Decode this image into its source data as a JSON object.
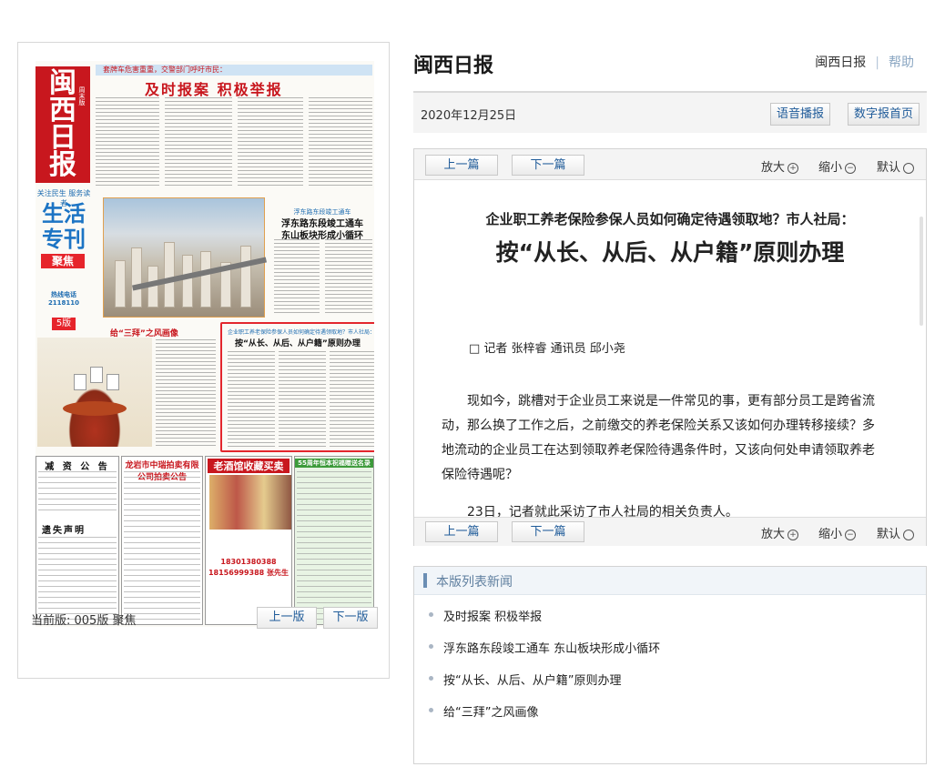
{
  "site": {
    "title": "闽西日报",
    "links": {
      "home": "闽西日报",
      "help": "帮助"
    }
  },
  "date_bar": {
    "date": "2020年12月25日",
    "voice_button": "语音播报",
    "digital_home_button": "数字报首页"
  },
  "newspaper": {
    "masthead_chars": [
      "闽",
      "西",
      "日",
      "报"
    ],
    "masthead_sub": "周末版",
    "slogan": "关注民生  服务读者",
    "life_title_line1": "生活",
    "life_title_line2": "专刊",
    "focus_tag": "聚焦",
    "phone": "热线电话 2118110",
    "page_badge": "5版",
    "banner_top": "套牌车危害重重，交警部门呼吁市民：",
    "big_head": "及时报案  积极举报",
    "sub_head_1_small": "浮东路东段竣工通车",
    "sub_head_1_line1": "浮东路东段竣工通车",
    "sub_head_1_line2": "东山板块形成小循环",
    "sub_head_2": "给“三拜”之风画像",
    "highlight_small": "企业职工养老保险参保人员如何确定待遇领取地？市人社局：",
    "highlight_title": "按“从长、从后、从户籍”原则办理",
    "ad_notice_title": "减 资 公 告",
    "ad_lost_title": "遗失声明",
    "ad_red_title": "龙岩市中瑞拍卖有限公司拍卖公告",
    "ad_collect_title": "老酒馆收藏买卖",
    "ad_collect_phone1": "18301380388",
    "ad_collect_phone2": "18156999388 张先生",
    "ad_green_title": "55周年恒本祝福赠送名录"
  },
  "paper_footer": {
    "current_page_label": "当前版: 005版 聚焦",
    "prev_page": "上一版",
    "next_page": "下一版"
  },
  "article": {
    "prev": "上一篇",
    "next": "下一篇",
    "zoom_in": "放大",
    "zoom_out": "缩小",
    "default": "默认",
    "subtitle": "企业职工养老保险参保人员如何确定待遇领取地？市人社局：",
    "title": "按“从长、从后、从户籍”原则办理",
    "author": "□ 记者 张梓睿 通讯员 邱小尧",
    "paragraph1": "现如今，跳槽对于企业员工来说是一件常见的事，更有部分员工是跨省流动，那么换了工作之后，之前缴交的养老保险关系又该如何办理转移接续？多地流动的企业员工在达到领取养老保险待遇条件时，又该向何处申请领取养老保险待遇呢？",
    "paragraph2": "23日，记者就此采访了市人社局的相关负责人。"
  },
  "news_list": {
    "heading": "本版列表新闻",
    "items": [
      "及时报案 积极举报",
      "浮东路东段竣工通车 东山板块形成小循环",
      "按“从长、从后、从户籍”原则办理",
      "给“三拜”之风画像"
    ]
  },
  "colors": {
    "brand_red": "#c8171e",
    "link_blue": "#1f5b99",
    "highlight_border": "#e3262d"
  }
}
